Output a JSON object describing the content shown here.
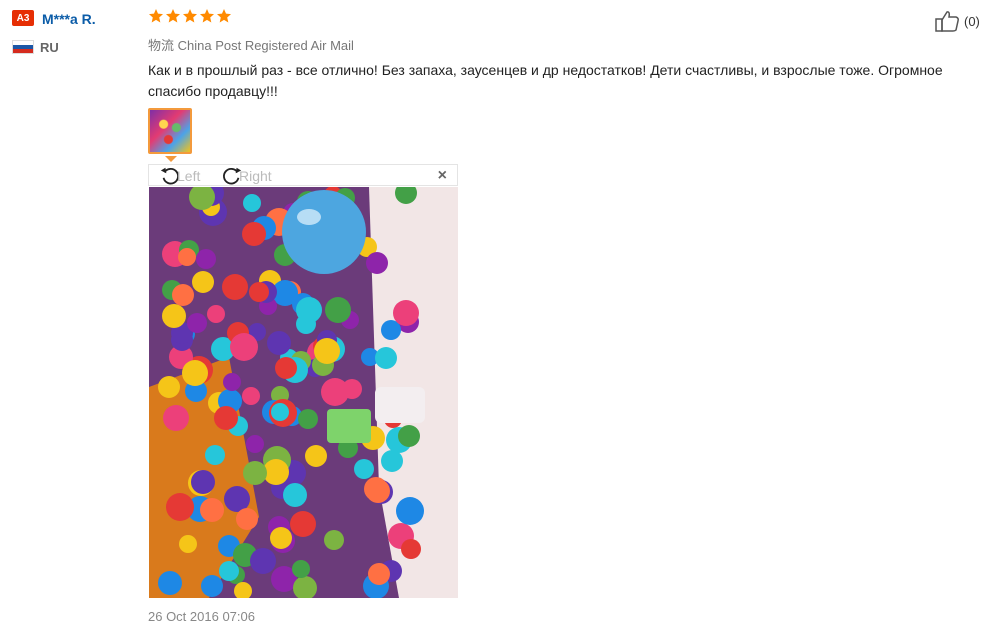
{
  "reviewer": {
    "level_badge": "A3",
    "name": "M***a R.",
    "country_code": "RU",
    "flag_colors": [
      "#ffffff",
      "#1c57a6",
      "#d52b1e"
    ]
  },
  "review": {
    "rating": 5,
    "rating_max": 5,
    "shipping": "物流 China Post Registered Air Mail",
    "text": "Как и в прошлый раз - все отлично! Без запаха, заусенцев и др недостатков! Дети счастливы, и взрослые тоже. Огромное спасибо продавцу!!!",
    "date": "26 Oct 2016 07:06",
    "likes": "(0)"
  },
  "viewer": {
    "rotate_left_label": "Left",
    "rotate_right_label": "Right",
    "close_label": "×",
    "photo_icon": "review-photo"
  },
  "colors": {
    "accent": "#f39a3c",
    "star": "#ff8a00",
    "link": "#0b5ca8",
    "badge": "#e62e04"
  }
}
